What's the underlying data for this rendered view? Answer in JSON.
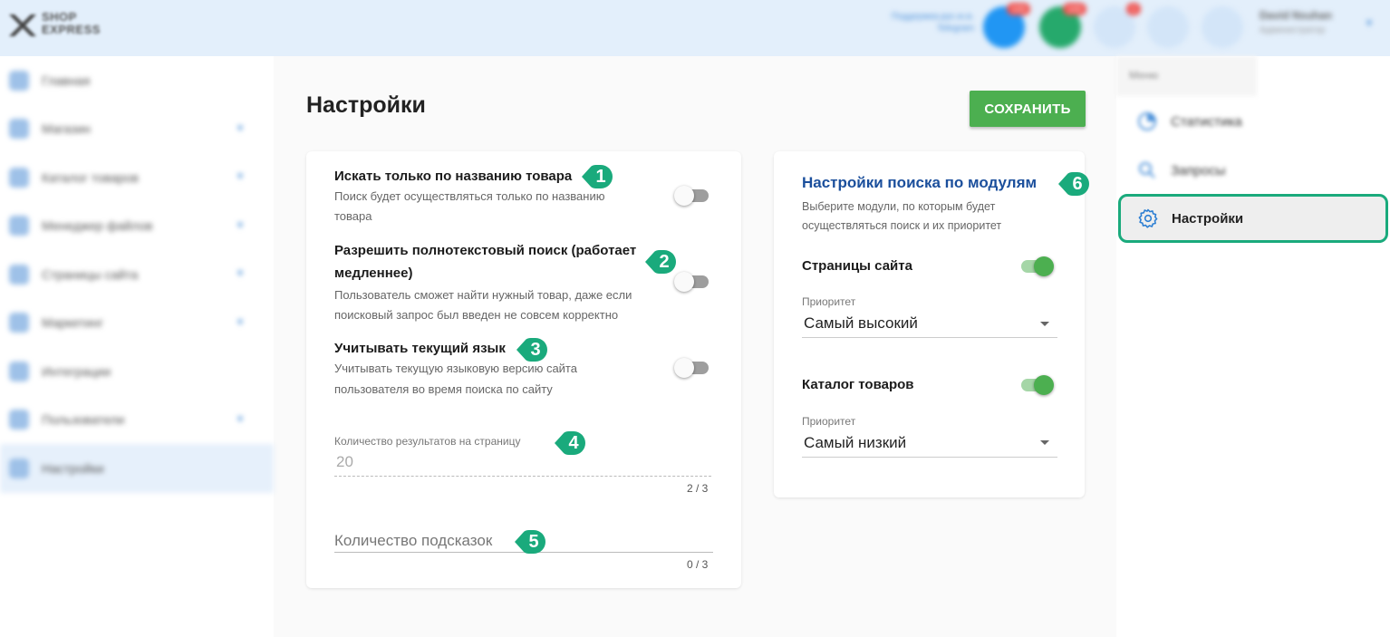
{
  "header": {
    "logo_text_line1": "SHOP",
    "logo_text_line2": "EXPRESS",
    "support_link": "Поддержка.рус.ю.в.",
    "support_link_2": "Telegram",
    "badges": [
      "123",
      "123",
      "1"
    ],
    "user_name": "David Nsuhan",
    "user_role": "Администратор"
  },
  "sidebar": {
    "items": [
      {
        "label": "Главная"
      },
      {
        "label": "Магазин"
      },
      {
        "label": "Каталог товаров"
      },
      {
        "label": "Менеджер файлов"
      },
      {
        "label": "Страницы сайта"
      },
      {
        "label": "Маркетинг"
      },
      {
        "label": "Интеграции"
      },
      {
        "label": "Пользователи"
      },
      {
        "label": "Настройки"
      }
    ]
  },
  "right_menu": {
    "title": "Меню",
    "items": [
      {
        "label": "Статистика"
      },
      {
        "label": "Запросы"
      },
      {
        "label": "Настройки"
      }
    ]
  },
  "page": {
    "title": "Настройки",
    "save_label": "СОХРАНИТЬ"
  },
  "options": [
    {
      "title": "Искать только по названию товара",
      "desc_line1": "Поиск будет осуществляться только по названию",
      "desc_line2": "товара",
      "enabled": false
    },
    {
      "title_line1": "Разрешить полнотекстовый поиск (работает",
      "title_line2": "медленнее)",
      "desc_line1": "Пользователь сможет найти нужный товар, даже если",
      "desc_line2": "поисковый запрос был введен не совсем корректно",
      "enabled": false
    },
    {
      "title": "Учитывать текущий язык",
      "desc_line1": "Учитывать текущую языковую версию сайта",
      "desc_line2": "пользователя во время поиска по сайту",
      "enabled": false
    }
  ],
  "results_field": {
    "label": "Количество результатов на страницу",
    "value": "20",
    "counter": "2 / 3"
  },
  "hints_field": {
    "placeholder": "Количество подсказок",
    "counter": "0 / 3"
  },
  "modules": {
    "title": "Настройки поиска по модулям",
    "desc_line1": "Выберите модули, по которым будет",
    "desc_line2": "осуществляться поиск и их приоритет",
    "items": [
      {
        "name": "Страницы сайта",
        "enabled": true,
        "priority_label": "Приоритет",
        "priority": "Самый высокий"
      },
      {
        "name": "Каталог товаров",
        "enabled": true,
        "priority_label": "Приоритет",
        "priority": "Самый низкий"
      }
    ]
  },
  "markers": [
    "1",
    "2",
    "3",
    "4",
    "5",
    "6"
  ],
  "colors": {
    "accent_green": "#4caf50",
    "marker_teal": "#1aaa7c",
    "title_blue": "#1b4f9c",
    "header_bg": "#e3effb"
  }
}
